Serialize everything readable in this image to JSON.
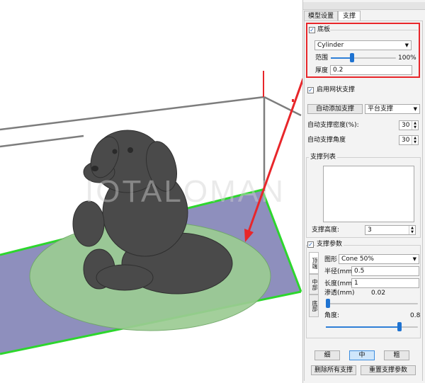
{
  "tabs": [
    {
      "label": "模型设置",
      "active": false
    },
    {
      "label": "支撑",
      "active": true
    }
  ],
  "raft": {
    "label": "底板",
    "checked": true,
    "shape_value": "Cylinder",
    "range_label": "范围",
    "range_value_text": "100%",
    "range_fraction": 0.33,
    "thickness_label": "厚度",
    "thickness_value": "0.2"
  },
  "mesh_support": {
    "label": "启用网状支撑",
    "checked": true
  },
  "auto_add_button": "自动添加支撑",
  "platform_select": "平台支撑",
  "density": {
    "label": "自动支撑密度(%):",
    "value": "30"
  },
  "angle": {
    "label": "自动支撑角度",
    "value": "30"
  },
  "support_list": {
    "title": "支撑列表"
  },
  "support_height": {
    "label": "支撑高度:",
    "value": "3"
  },
  "support_params": {
    "label": "支撑参数",
    "checked": true,
    "vtabs": [
      "顶端",
      "中部",
      "底部"
    ],
    "shape_label": "图形",
    "shape_value": "Cone 50%",
    "radius_label": "半径(mm)",
    "radius_value": "0.5",
    "length_label": "长度(mm)",
    "length_value": "1",
    "penetration_label": "渗透(mm)",
    "penetration_value": "0.02",
    "penetration_fraction": 0.02,
    "angle_label": "角度:",
    "angle_value": "0.8",
    "angle_fraction": 0.8
  },
  "size_buttons": [
    {
      "label": "细",
      "selected": false
    },
    {
      "label": "中",
      "selected": true
    },
    {
      "label": "粗",
      "selected": false
    }
  ],
  "delete_all_button": "删除所有支撑",
  "reset_params_button": "重置支撑参数",
  "colors": {
    "accent": "#1f73d1",
    "highlight_red": "#e8262a",
    "platform": "#8e8fbd",
    "platform_edge": "#2dd62d",
    "raft_disc": "#9ccc93"
  }
}
